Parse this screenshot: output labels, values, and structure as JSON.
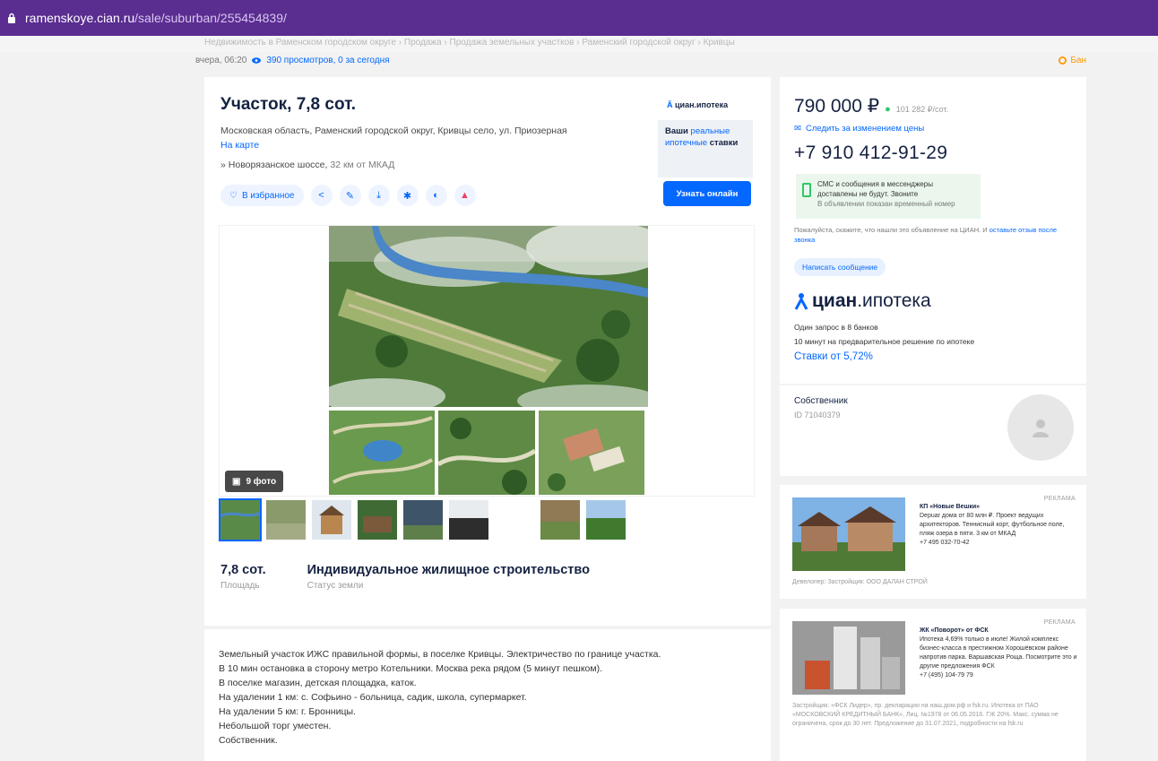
{
  "browser": {
    "host": "ramenskoye.cian.ru",
    "path": "/sale/suburban/255454839/"
  },
  "breadcrumbs_faded": "Недвижимость в Раменском городском округе › Продажа › Продажа земельных участков › Раменский городской округ › Кривцы",
  "meta": {
    "date": "вчера, 06:20",
    "views": "390 просмотров, 0 за сегодня",
    "report": "Бан"
  },
  "listing": {
    "title": "Участок, 7,8 сот.",
    "address": "Московская область, Раменский городской округ, Кривцы село, ул. Приозерная",
    "map_link": "На карте",
    "highway": "Новорязанское шоссе,",
    "distance": "32 км от МКАД",
    "favorite_label": "В избранное",
    "photo_count": "9 фото",
    "facts": [
      {
        "value": "7,8 сот.",
        "label": "Площадь"
      },
      {
        "value": "Индивидуальное жилищное строительство",
        "label": "Статус земли"
      }
    ],
    "description": [
      "Земельный участок ИЖС правильной формы, в поселке Кривцы. Электричество по границе участка.",
      "В 10 мин остановка в сторону метро Котельники. Москва река рядом (5 минут пешком).",
      "В поселке магазин, детская площадка, каток.",
      "На удалении 1 км: с. Софьино - больница, садик, школа, супермаркет.",
      "На удалении 5 км: г. Бронницы.",
      "Небольшой торг уместен.",
      "Собственник."
    ]
  },
  "promo": {
    "logo_mark": "Ä",
    "logo_text": "циан.ипотека",
    "line1": "Ваши",
    "highlight": "реальные ипотечные",
    "line3": "ставки",
    "button": "Узнать онлайн"
  },
  "price_card": {
    "price": "790 000 ₽",
    "price_per": "101 282 ₽/сот.",
    "track": "Следить за изменением цены",
    "phone": "+7 910 412-91-29",
    "sms_title": "СМС и сообщения в мессенджеры доставлены не будут. Звоните",
    "sms_note": "В объявлении показан временный номер",
    "disclaimer": "Пожалуйста, скажите, что нашли это объявление на ЦИАН. И",
    "disclaimer_link": "оставьте отзыв после звонка",
    "message_button": "Написать сообщение",
    "cian_logo_bold": "циан",
    "cian_logo_thin": ".ипотека",
    "mortgage_line1": "Один запрос в 8 банков",
    "mortgage_line2": "10 минут на предварительное решение по ипотеке",
    "mortgage_rate": "Ставки от 5,72%"
  },
  "owner": {
    "label": "Собственник",
    "id": "ID 71040379"
  },
  "ads": [
    {
      "label": "РЕКЛАМА",
      "title": "КП «Новые Вешки»",
      "text": "Depuar дома от 80 млн ₽. Проект ведущих архитекторов. Теннисный корт, футбольное поле, пляж озера в пяти. 3 км от МКАД",
      "phone": "+7 495 032-70-42",
      "foot": "Девелопер: Застройщик: ООО ДАЛАН СТРОЙ"
    },
    {
      "label": "РЕКЛАМА",
      "title": "ЖК «Поворот» от ФСК",
      "text": "Ипотека 4,69% только в июле! Жилой комплекс бизнес-класса в престижном Хорошёвском районе напротив парка. Варшавская Роща. Посмотрите это и другие предложения ФСК",
      "phone": "+7 (495) 104-79 79",
      "foot": "Застройщик: «ФСК Лидер», пр. декларации на наш.дом.рф и fsk.ru. Ипотека от ПАО «МОСКОВСКИЙ КРЕДИТНЫЙ БАНК», Лиц. №1978 от 06.05.2016. ГЖ 20%. Макс. сумма не ограничена, срок до 30 лет. Предложение до 31.07.2021, подробности на fsk.ru"
    }
  ]
}
